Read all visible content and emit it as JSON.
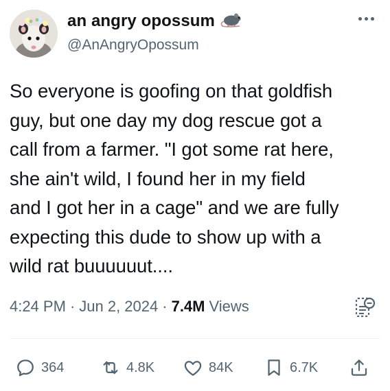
{
  "author": {
    "display_name": "an angry opossum",
    "handle": "@AnAngryOpossum",
    "badge_icon": "rat-icon",
    "avatar": "opossum-with-flower-crown"
  },
  "tweet": {
    "text": "So everyone is goofing on that goldfish\nguy, but one day my dog rescue got a\ncall from a farmer. \"I got some rat here,\nshe ain't wild, I found her in my field\nand I got her in a cage\" and we are fully\nexpecting this dude to show up with a\nwild rat buuuuuut....",
    "time": "4:24 PM",
    "date": "Jun 2, 2024",
    "sep": "·",
    "views_count": "7.4M",
    "views_label": "Views"
  },
  "actions": {
    "replies": "364",
    "reposts": "4.8K",
    "likes": "84K",
    "bookmarks": "6.7K"
  },
  "colors": {
    "text": "#0f1419",
    "secondary": "#536471",
    "divider": "#eff3f4"
  }
}
